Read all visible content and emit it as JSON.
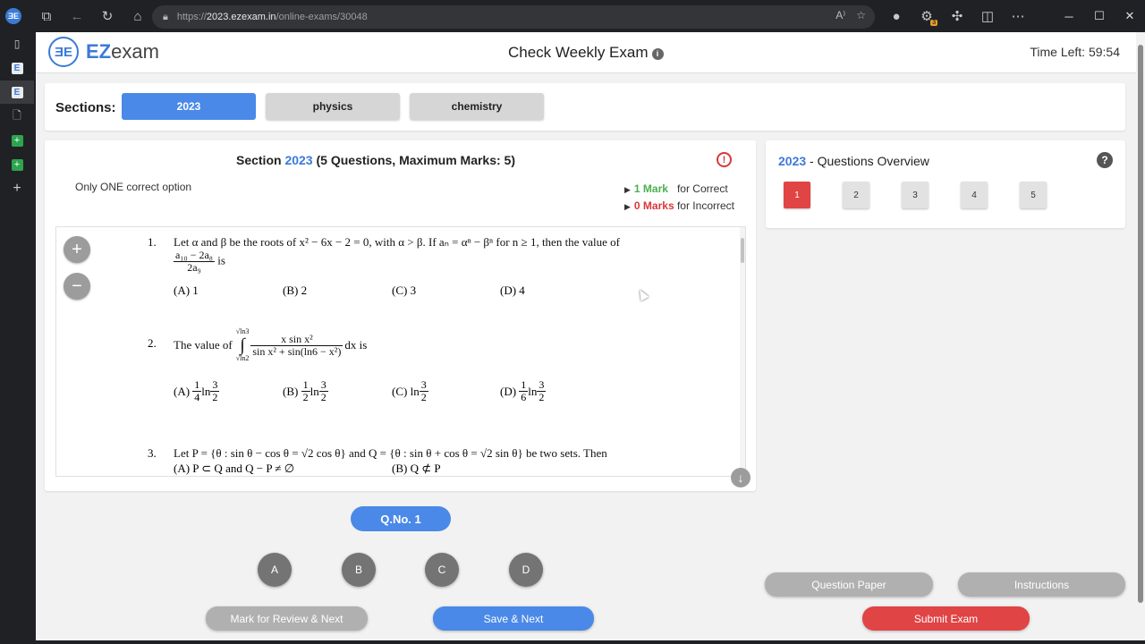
{
  "browser": {
    "url_prefix": "https://",
    "url_domain": "2023.ezexam.in",
    "url_path": "/online-exams/30048",
    "badge_count": "3"
  },
  "header": {
    "logo_mark": "ƎE",
    "logo_ez": "EZ",
    "logo_rest": "exam",
    "title": "Check Weekly Exam",
    "info_symbol": "i",
    "time_left": "Time Left: 59:54"
  },
  "sections": {
    "label": "Sections:",
    "items": [
      {
        "label": "2023",
        "active": true
      },
      {
        "label": "physics",
        "active": false
      },
      {
        "label": "chemistry",
        "active": false
      }
    ]
  },
  "question_panel": {
    "title_prefix": "Section",
    "section_name": "2023",
    "title_suffix": "(5 Questions, Maximum Marks: 5)",
    "instruction": "Only ONE correct option",
    "correct_marks": "1 Mark",
    "correct_label": "for Correct",
    "incorrect_marks": "0 Marks",
    "incorrect_label": "for Incorrect",
    "questions": [
      {
        "num": "1.",
        "text": "Let α and β be the roots of x² − 6x − 2 = 0, with α > β. If aₙ = αⁿ − βⁿ for n ≥ 1, then the value of",
        "frac_num": "a₁₀ − 2a₈",
        "frac_den": "2a₉",
        "frac_tail": "is",
        "options": [
          "(A) 1",
          "(B) 2",
          "(C) 3",
          "(D) 4"
        ]
      },
      {
        "num": "2.",
        "text_pre": "The value of",
        "upper": "√ln3",
        "lower": "√ln2",
        "integrand_num": "x sin x²",
        "integrand_den": "sin x² + sin(ln6 − x²)",
        "text_post": "dx  is",
        "options": [
          {
            "label": "(A)",
            "num": "1",
            "den": "4",
            "ln": "ln",
            "lnnum": "3",
            "lnden": "2"
          },
          {
            "label": "(B)",
            "num": "1",
            "den": "2",
            "ln": "ln",
            "lnnum": "3",
            "lnden": "2"
          },
          {
            "label": "(C)",
            "ln": "ln",
            "lnnum": "3",
            "lnden": "2"
          },
          {
            "label": "(D)",
            "num": "1",
            "den": "6",
            "ln": "ln",
            "lnnum": "3",
            "lnden": "2"
          }
        ]
      },
      {
        "num": "3.",
        "text": "Let P = {θ : sin θ − cos θ = √2 cos θ} and Q = {θ : sin θ + cos θ = √2 sin θ} be two sets. Then",
        "options": [
          "(A) P ⊂ Q and Q − P ≠ ∅",
          "(B) Q ⊄ P"
        ]
      }
    ]
  },
  "overview": {
    "section_name": "2023",
    "title_suffix": "- Questions Overview",
    "boxes": [
      "1",
      "2",
      "3",
      "4",
      "5"
    ]
  },
  "controls": {
    "qno": "Q.No. 1",
    "answers": [
      "A",
      "B",
      "C",
      "D"
    ],
    "mark_review": "Mark for Review & Next",
    "save_next": "Save & Next",
    "question_paper": "Question Paper",
    "instructions": "Instructions",
    "submit": "Submit Exam"
  },
  "colors": {
    "accent": "#4a89e8",
    "danger": "#e04444",
    "success": "#4caf50"
  }
}
